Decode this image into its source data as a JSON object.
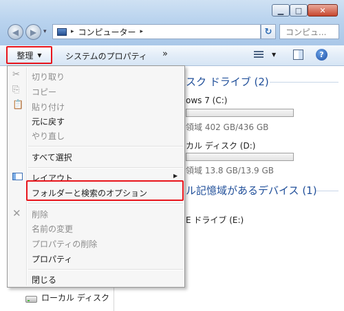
{
  "address": {
    "crumb": "コンピューター"
  },
  "search": {
    "placeholder": "コンピュ..."
  },
  "toolbar": {
    "organize_label": "整理",
    "system_properties_label": "システムのプロパティ",
    "more_label": "»"
  },
  "content": {
    "hdd_group_title": "スク ドライブ (2)",
    "drive_c_name": "ows 7 (C:)",
    "drive_c_free": "領域 402 GB/436 GB",
    "drive_c_fill": 0.08,
    "drive_d_name": "カル ディスク (D:)",
    "drive_d_free": "領域 13.8 GB/13.9 GB",
    "drive_d_fill": 0.01,
    "removable_group_title": "ル記憶域があるデバイス (1)",
    "dvd_name": "E ドライブ (E:)"
  },
  "navpane": {
    "local_disk_label": "ローカル ディスク"
  },
  "menu": {
    "cut": "切り取り",
    "copy": "コピー",
    "paste": "貼り付け",
    "undo": "元に戻す",
    "redo": "やり直し",
    "select_all": "すべて選択",
    "layout": "レイアウト",
    "folder_options": "フォルダーと検索のオプション",
    "delete": "削除",
    "rename": "名前の変更",
    "remove_properties": "プロパティの削除",
    "properties": "プロパティ",
    "close": "閉じる"
  },
  "icons": {
    "cut": "scissors-icon",
    "copy": "copy-icon",
    "paste": "paste-icon",
    "layout": "layout-icon",
    "delete": "delete-x-icon"
  }
}
